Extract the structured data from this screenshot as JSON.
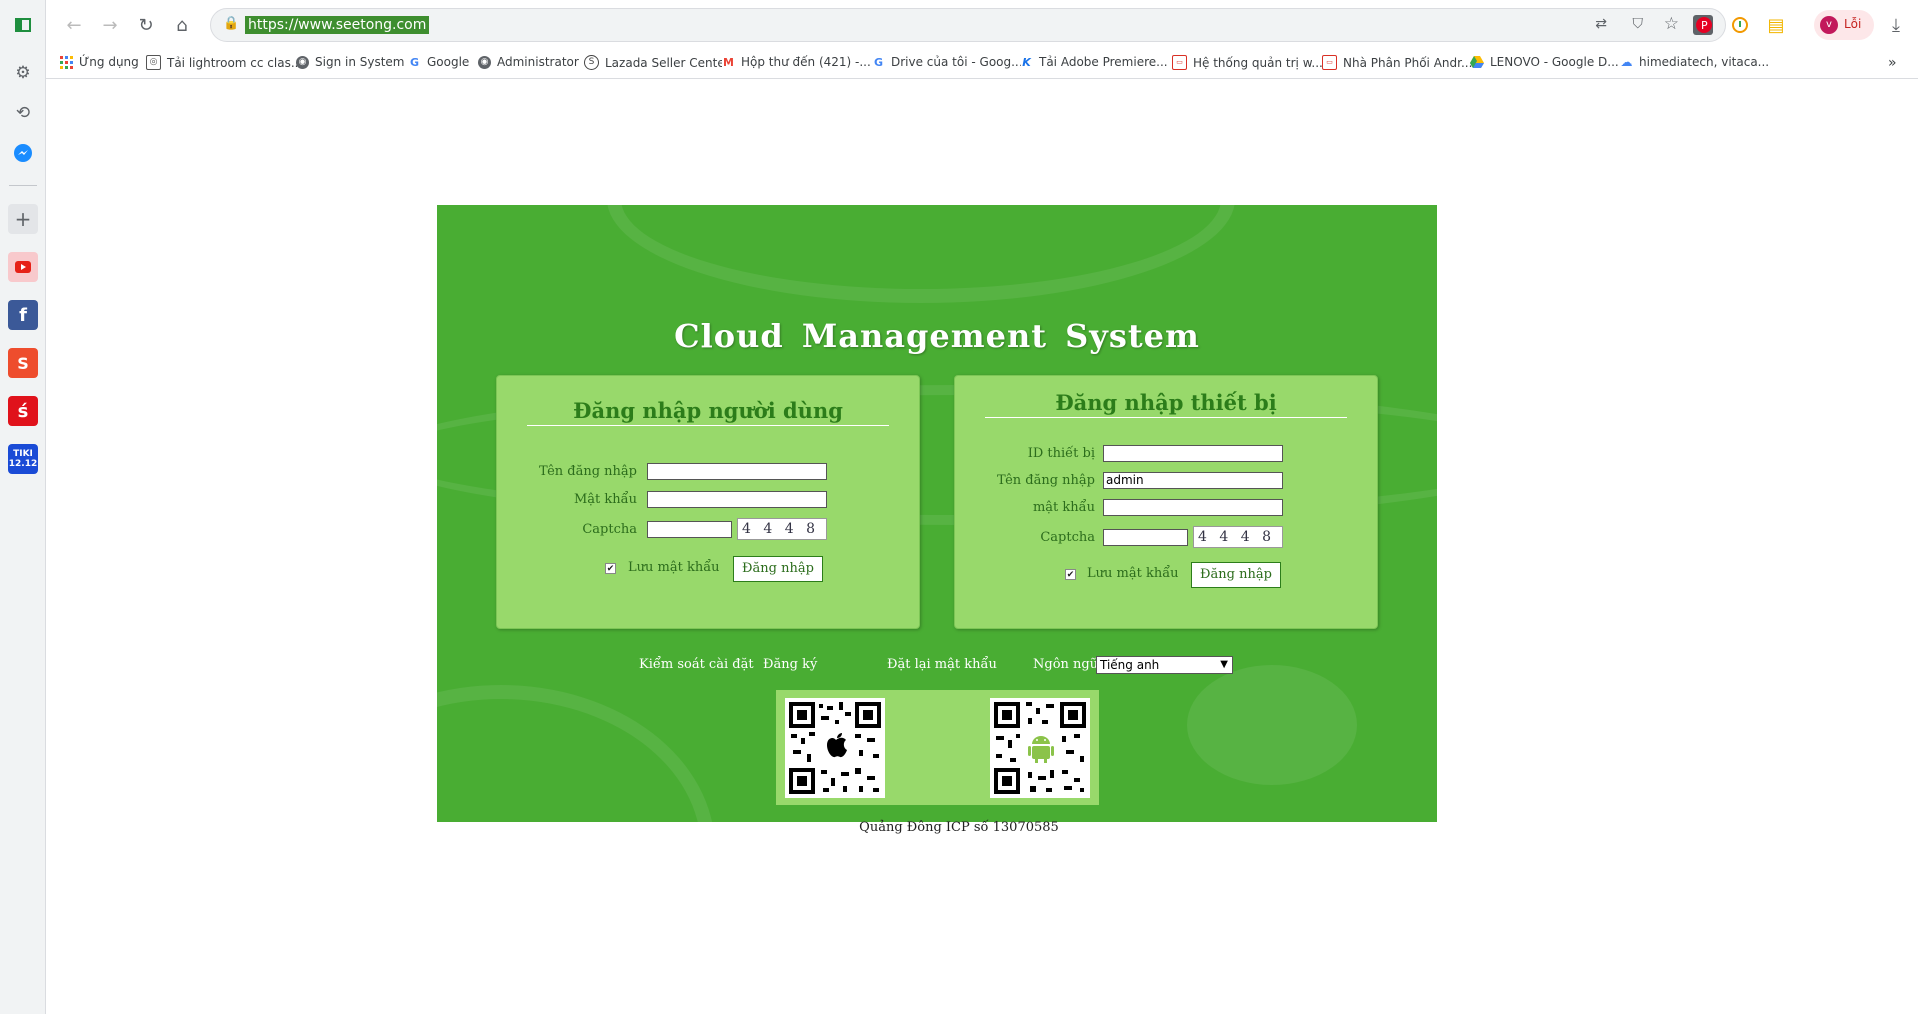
{
  "browser": {
    "url": "https://www.seetong.com",
    "profile_label": "Lỗi",
    "profile_initial": "v"
  },
  "bookmarks": [
    {
      "label": "Ứng dụng",
      "icon": "apps-grid-icon"
    },
    {
      "label": "Tải lightroom cc clas...",
      "icon": "camera-icon"
    },
    {
      "label": "Sign in System",
      "icon": "globe-icon"
    },
    {
      "label": "Google",
      "icon": "google-icon"
    },
    {
      "label": "Administrator",
      "icon": "globe-icon"
    },
    {
      "label": "Lazada Seller Center",
      "icon": "lazada-icon"
    },
    {
      "label": "Hộp thư đến (421) -...",
      "icon": "gmail-icon"
    },
    {
      "label": "Drive của tôi - Goog...",
      "icon": "google-icon"
    },
    {
      "label": "Tải Adobe Premiere...",
      "icon": "k-icon"
    },
    {
      "label": "Hệ thống quản trị w...",
      "icon": "tv-icon"
    },
    {
      "label": "Nhà Phân Phối Andr...",
      "icon": "tv-icon"
    },
    {
      "label": "LENOVO - Google D...",
      "icon": "drive-icon"
    },
    {
      "label": "himediatech, vitaca...",
      "icon": "cloud-icon"
    }
  ],
  "page": {
    "title": "Cloud  Management  System",
    "user_login": {
      "heading": "Đăng nhập người dùng",
      "username_label": "Tên đăng nhập",
      "username_value": "",
      "password_label": "Mật khẩu",
      "captcha_label": "Captcha",
      "captcha_text": "4 4 4 8",
      "captcha_small": "1",
      "remember_label": "Lưu mật khẩu",
      "remember_checked": true,
      "login_button": "Đăng nhập"
    },
    "device_login": {
      "heading": "Đăng nhập thiết bị",
      "device_id_label": "ID thiết bị",
      "device_id_value": "",
      "username_label": "Tên đăng nhập",
      "username_value": "admin",
      "password_label": "mật khẩu",
      "captcha_label": "Captcha",
      "captcha_text": "4 4 4 8",
      "captcha_small": "1",
      "remember_label": "Lưu mật khẩu",
      "remember_checked": true,
      "login_button": "Đăng nhập"
    },
    "links": {
      "install_control": "Kiểm soát cài đặt",
      "register": "Đăng ký",
      "reset_password": "Đặt lại mật khẩu",
      "language_label": "Ngôn ngữ",
      "language_value": "Tiếng anh"
    },
    "footer": "Quảng Đông ICP số 13070585"
  },
  "colors": {
    "panel": "#49ad33",
    "card": "#98d96b",
    "heading": "#2c7d1a"
  }
}
